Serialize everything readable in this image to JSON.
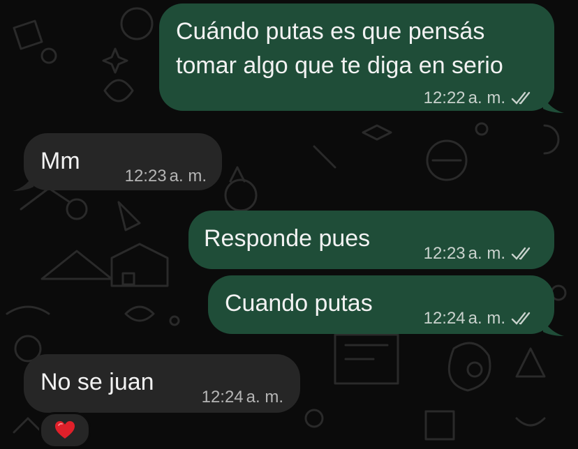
{
  "messages": [
    {
      "direction": "outgoing",
      "lines": [
        "Cuándo putas es que pensás",
        "tomar algo que te diga en serio"
      ],
      "time": "12:22",
      "ampm": "a. m.",
      "status": "read"
    },
    {
      "direction": "incoming",
      "lines": [
        "Mm"
      ],
      "time": "12:23",
      "ampm": "a. m."
    },
    {
      "direction": "outgoing",
      "lines": [
        "Responde pues"
      ],
      "time": "12:23",
      "ampm": "a. m.",
      "status": "read"
    },
    {
      "direction": "outgoing",
      "lines": [
        "Cuando putas"
      ],
      "time": "12:24",
      "ampm": "a. m.",
      "status": "read"
    },
    {
      "direction": "incoming",
      "lines": [
        "No se juan"
      ],
      "time": "12:24",
      "ampm": "a. m.",
      "reaction_icon": "red-heart-icon"
    }
  ],
  "colors": {
    "background": "#0b0b0b",
    "outgoing_bubble": "#1f4d38",
    "incoming_bubble": "#262626",
    "read_ticks": "#c9d2cd",
    "heart": "#e0202a"
  }
}
